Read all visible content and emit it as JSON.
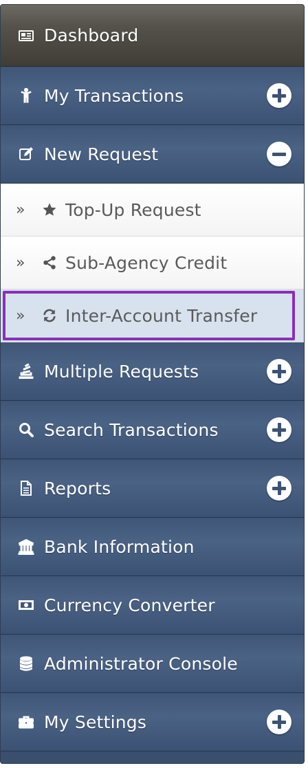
{
  "menu": {
    "dashboard": {
      "label": "Dashboard",
      "icon": "newspaper-icon"
    },
    "my_transactions": {
      "label": "My Transactions",
      "icon": "person-icon",
      "toggle": "expand"
    },
    "new_request": {
      "label": "New Request",
      "icon": "edit-icon",
      "toggle": "collapse"
    },
    "sub_items": [
      {
        "label": "Top-Up Request",
        "icon": "star-icon",
        "prefix": "»"
      },
      {
        "label": "Sub-Agency Credit",
        "icon": "share-icon",
        "prefix": "»"
      },
      {
        "label": "Inter-Account Transfer",
        "icon": "refresh-icon",
        "prefix": "»",
        "active": true
      }
    ],
    "multiple_requests": {
      "label": "Multiple Requests",
      "icon": "stack-icon",
      "toggle": "expand"
    },
    "search_transactions": {
      "label": "Search Transactions",
      "icon": "search-icon",
      "toggle": "expand"
    },
    "reports": {
      "label": "Reports",
      "icon": "document-icon",
      "toggle": "expand"
    },
    "bank_information": {
      "label": "Bank Information",
      "icon": "bank-icon"
    },
    "currency_converter": {
      "label": "Currency Converter",
      "icon": "money-icon"
    },
    "administrator_console": {
      "label": "Administrator Console",
      "icon": "database-icon"
    },
    "my_settings": {
      "label": "My Settings",
      "icon": "briefcase-icon",
      "toggle": "expand"
    }
  },
  "colors": {
    "menu_blue": "#3f5677",
    "dashboard_gray": "#55524b",
    "highlight_purple": "#8a2fb8"
  }
}
